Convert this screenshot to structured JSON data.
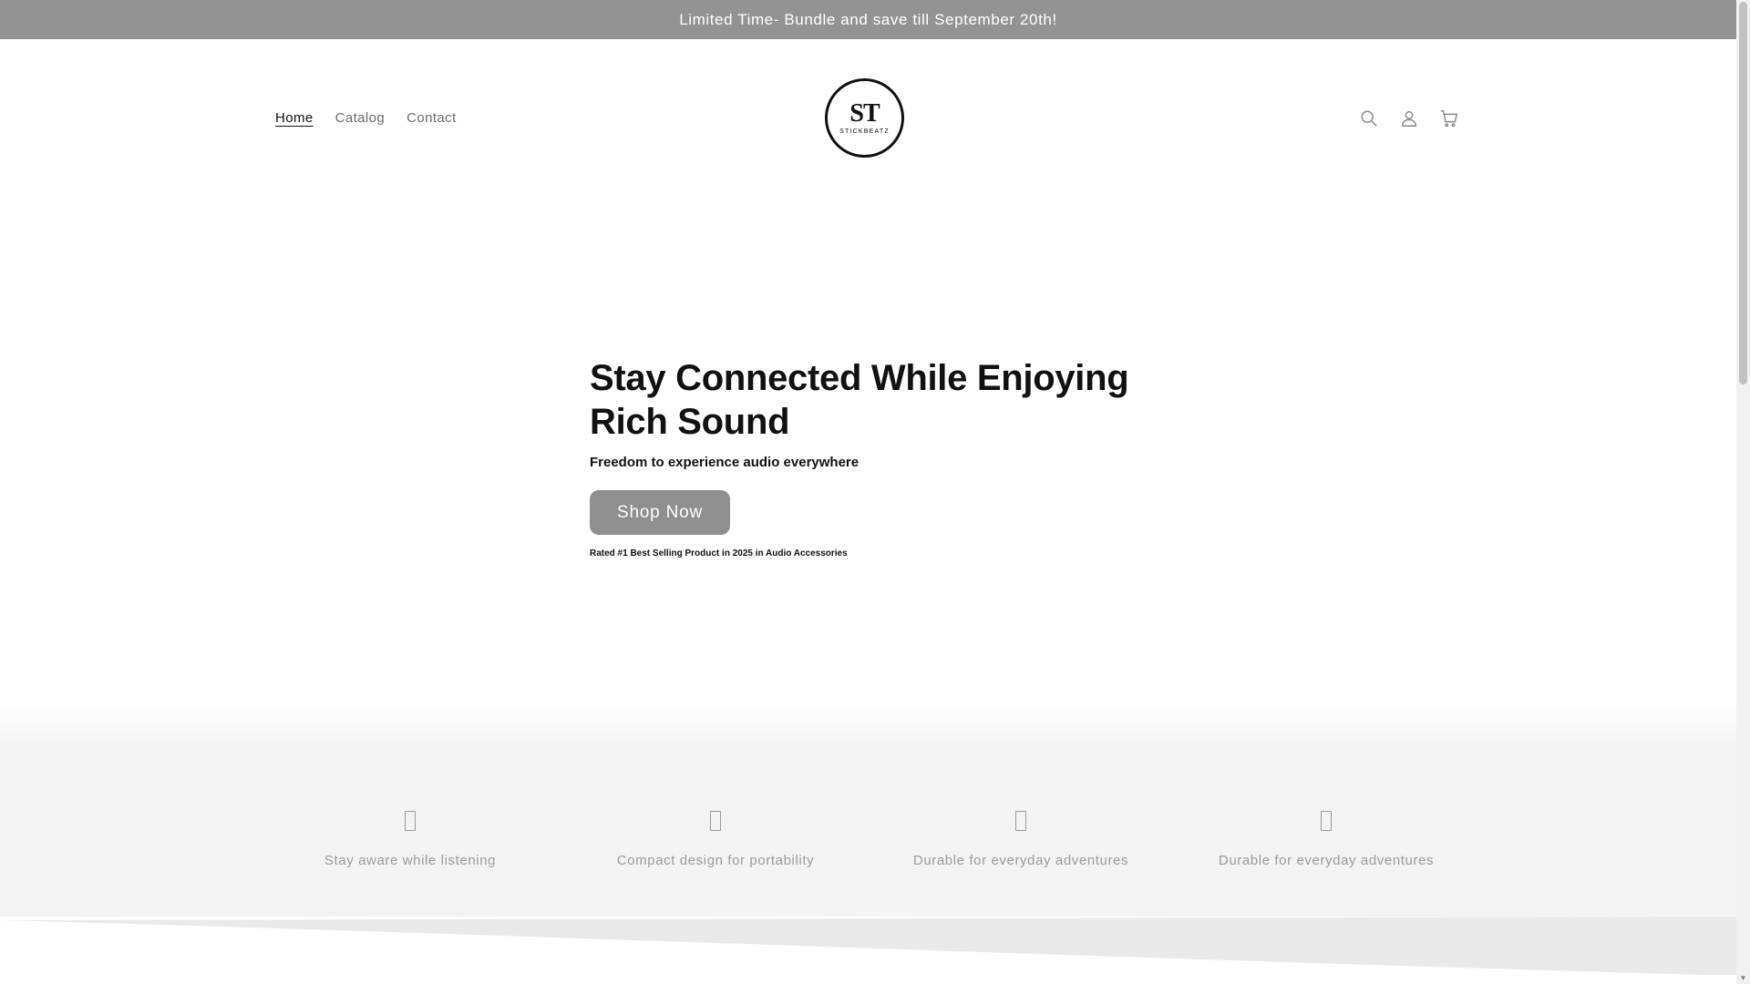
{
  "announcement": {
    "text": "Limited Time- Bundle and save till September 20th!"
  },
  "header": {
    "nav": [
      {
        "label": "Home",
        "active": true
      },
      {
        "label": "Catalog",
        "active": false
      },
      {
        "label": "Contact",
        "active": false
      }
    ],
    "logo": {
      "mark": "ST",
      "sub": "STICKBEATZ"
    },
    "icons": [
      "search-icon",
      "account-icon",
      "cart-icon"
    ]
  },
  "hero": {
    "title": "Stay Connected While Enjoying Rich Sound",
    "subtitle": "Freedom to experience audio everywhere",
    "button_label": "Shop Now",
    "rating": "Rated #1 Best Selling Product in 2025 in Audio Accessories"
  },
  "features": [
    {
      "text": "Stay aware while listening",
      "icon": "feature-icon"
    },
    {
      "text": "Compact design for portability",
      "icon": "feature-icon"
    },
    {
      "text": "Durable for everyday adventures",
      "icon": "feature-icon"
    },
    {
      "text": "Durable for everyday adventures",
      "icon": "feature-icon"
    }
  ],
  "colors": {
    "announcement_bg": "#939393",
    "button_bg": "#8f8f8f",
    "features_bg": "#f3f3f3",
    "text": "#121212"
  }
}
